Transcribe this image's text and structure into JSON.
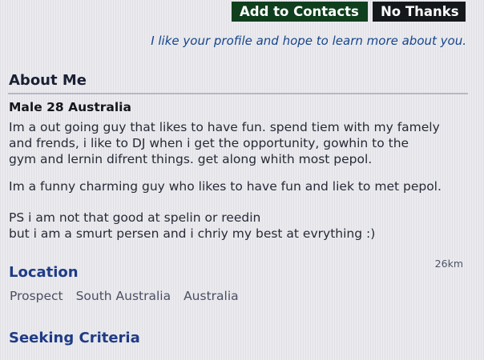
{
  "header": {
    "add_contacts_label": "Add to Contacts",
    "no_thanks_label": "No Thanks",
    "tagline": "I like your profile and hope to learn more about you."
  },
  "about": {
    "title": "About Me",
    "summary": "Male 28 Australia",
    "paragraphs": [
      "Im a out going guy that likes to have fun. spend tiem with my famely\nand frends, i like to DJ when i get the opportunity, gowhin to the\ngym and lernin difrent things. get along whith most pepol.",
      "Im a funny charming guy who likes to have fun and liek to met pepol.",
      "PS i am not that good at spelin or reedin\nbut i am a smurt persen and i chriy my best at evrything :)"
    ]
  },
  "location": {
    "title": "Location",
    "distance": "26km",
    "suburb": "Prospect",
    "state": "South Australia",
    "country": "Australia"
  },
  "seeking": {
    "title": "Seeking Criteria"
  }
}
